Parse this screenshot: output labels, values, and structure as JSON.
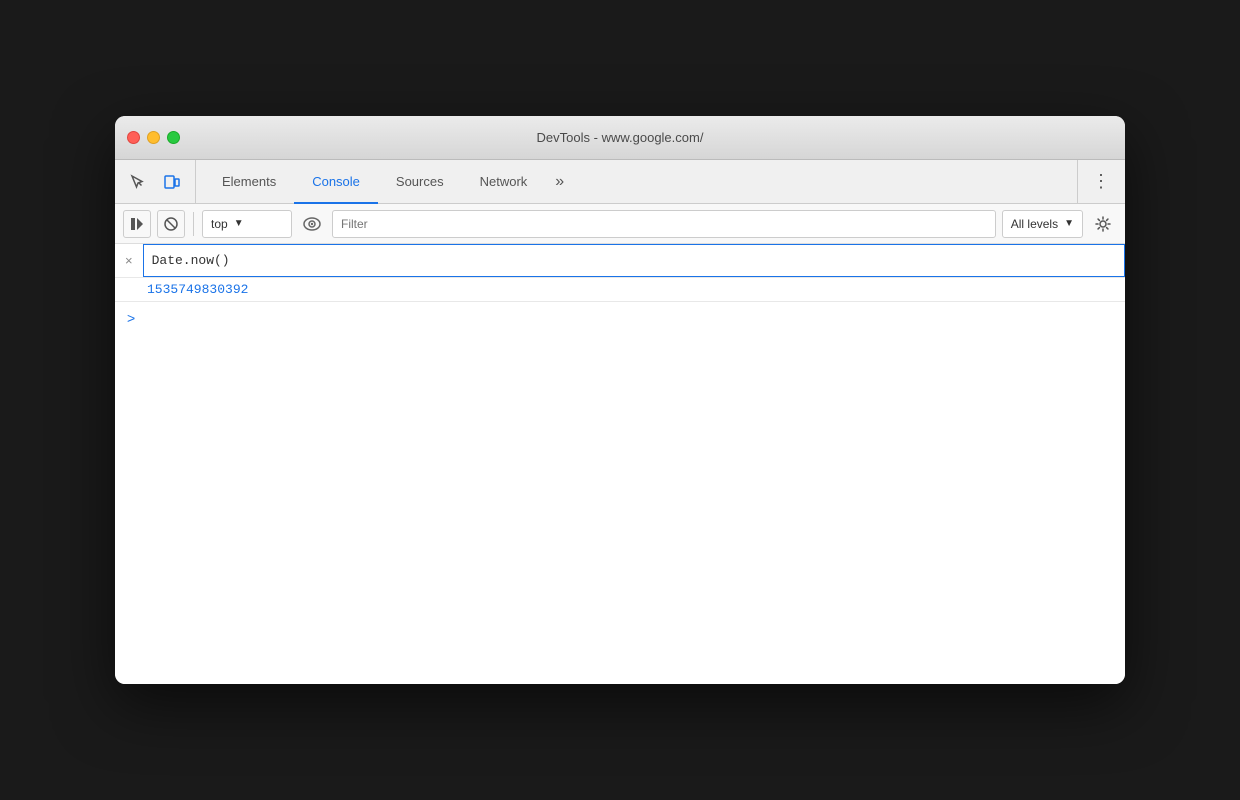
{
  "window": {
    "title": "DevTools - www.google.com/"
  },
  "tabs": {
    "items": [
      {
        "id": "elements",
        "label": "Elements",
        "active": false
      },
      {
        "id": "console",
        "label": "Console",
        "active": true
      },
      {
        "id": "sources",
        "label": "Sources",
        "active": false
      },
      {
        "id": "network",
        "label": "Network",
        "active": false
      }
    ],
    "more_label": "»"
  },
  "console_toolbar": {
    "context_value": "top",
    "context_arrow": "▼",
    "filter_placeholder": "Filter",
    "levels_label": "All levels",
    "levels_arrow": "▼"
  },
  "console_content": {
    "input_value": "Date.now()",
    "result_value": "1535749830392",
    "prompt_symbol": ">"
  }
}
